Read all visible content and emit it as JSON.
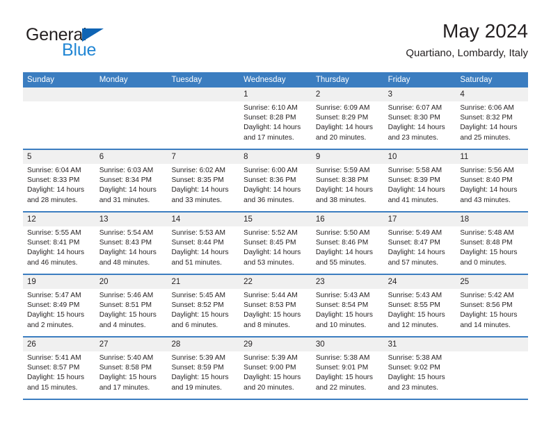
{
  "logo": {
    "text_top": "General",
    "text_bottom": "Blue",
    "triangle_icon": "triangle-icon",
    "color_dark": "#231f20",
    "color_blue": "#2186d4"
  },
  "header": {
    "title": "May 2024",
    "subtitle": "Quartiano, Lombardy, Italy"
  },
  "theme": {
    "header_blue": "#3b7dc0",
    "day_head_gray": "#f0f0f0",
    "text": "#231f20"
  },
  "weekdays": [
    "Sunday",
    "Monday",
    "Tuesday",
    "Wednesday",
    "Thursday",
    "Friday",
    "Saturday"
  ],
  "weeks": [
    [
      {
        "day": "",
        "lines": []
      },
      {
        "day": "",
        "lines": []
      },
      {
        "day": "",
        "lines": []
      },
      {
        "day": "1",
        "lines": [
          "Sunrise: 6:10 AM",
          "Sunset: 8:28 PM",
          "Daylight: 14 hours",
          "and 17 minutes."
        ]
      },
      {
        "day": "2",
        "lines": [
          "Sunrise: 6:09 AM",
          "Sunset: 8:29 PM",
          "Daylight: 14 hours",
          "and 20 minutes."
        ]
      },
      {
        "day": "3",
        "lines": [
          "Sunrise: 6:07 AM",
          "Sunset: 8:30 PM",
          "Daylight: 14 hours",
          "and 23 minutes."
        ]
      },
      {
        "day": "4",
        "lines": [
          "Sunrise: 6:06 AM",
          "Sunset: 8:32 PM",
          "Daylight: 14 hours",
          "and 25 minutes."
        ]
      }
    ],
    [
      {
        "day": "5",
        "lines": [
          "Sunrise: 6:04 AM",
          "Sunset: 8:33 PM",
          "Daylight: 14 hours",
          "and 28 minutes."
        ]
      },
      {
        "day": "6",
        "lines": [
          "Sunrise: 6:03 AM",
          "Sunset: 8:34 PM",
          "Daylight: 14 hours",
          "and 31 minutes."
        ]
      },
      {
        "day": "7",
        "lines": [
          "Sunrise: 6:02 AM",
          "Sunset: 8:35 PM",
          "Daylight: 14 hours",
          "and 33 minutes."
        ]
      },
      {
        "day": "8",
        "lines": [
          "Sunrise: 6:00 AM",
          "Sunset: 8:36 PM",
          "Daylight: 14 hours",
          "and 36 minutes."
        ]
      },
      {
        "day": "9",
        "lines": [
          "Sunrise: 5:59 AM",
          "Sunset: 8:38 PM",
          "Daylight: 14 hours",
          "and 38 minutes."
        ]
      },
      {
        "day": "10",
        "lines": [
          "Sunrise: 5:58 AM",
          "Sunset: 8:39 PM",
          "Daylight: 14 hours",
          "and 41 minutes."
        ]
      },
      {
        "day": "11",
        "lines": [
          "Sunrise: 5:56 AM",
          "Sunset: 8:40 PM",
          "Daylight: 14 hours",
          "and 43 minutes."
        ]
      }
    ],
    [
      {
        "day": "12",
        "lines": [
          "Sunrise: 5:55 AM",
          "Sunset: 8:41 PM",
          "Daylight: 14 hours",
          "and 46 minutes."
        ]
      },
      {
        "day": "13",
        "lines": [
          "Sunrise: 5:54 AM",
          "Sunset: 8:43 PM",
          "Daylight: 14 hours",
          "and 48 minutes."
        ]
      },
      {
        "day": "14",
        "lines": [
          "Sunrise: 5:53 AM",
          "Sunset: 8:44 PM",
          "Daylight: 14 hours",
          "and 51 minutes."
        ]
      },
      {
        "day": "15",
        "lines": [
          "Sunrise: 5:52 AM",
          "Sunset: 8:45 PM",
          "Daylight: 14 hours",
          "and 53 minutes."
        ]
      },
      {
        "day": "16",
        "lines": [
          "Sunrise: 5:50 AM",
          "Sunset: 8:46 PM",
          "Daylight: 14 hours",
          "and 55 minutes."
        ]
      },
      {
        "day": "17",
        "lines": [
          "Sunrise: 5:49 AM",
          "Sunset: 8:47 PM",
          "Daylight: 14 hours",
          "and 57 minutes."
        ]
      },
      {
        "day": "18",
        "lines": [
          "Sunrise: 5:48 AM",
          "Sunset: 8:48 PM",
          "Daylight: 15 hours",
          "and 0 minutes."
        ]
      }
    ],
    [
      {
        "day": "19",
        "lines": [
          "Sunrise: 5:47 AM",
          "Sunset: 8:49 PM",
          "Daylight: 15 hours",
          "and 2 minutes."
        ]
      },
      {
        "day": "20",
        "lines": [
          "Sunrise: 5:46 AM",
          "Sunset: 8:51 PM",
          "Daylight: 15 hours",
          "and 4 minutes."
        ]
      },
      {
        "day": "21",
        "lines": [
          "Sunrise: 5:45 AM",
          "Sunset: 8:52 PM",
          "Daylight: 15 hours",
          "and 6 minutes."
        ]
      },
      {
        "day": "22",
        "lines": [
          "Sunrise: 5:44 AM",
          "Sunset: 8:53 PM",
          "Daylight: 15 hours",
          "and 8 minutes."
        ]
      },
      {
        "day": "23",
        "lines": [
          "Sunrise: 5:43 AM",
          "Sunset: 8:54 PM",
          "Daylight: 15 hours",
          "and 10 minutes."
        ]
      },
      {
        "day": "24",
        "lines": [
          "Sunrise: 5:43 AM",
          "Sunset: 8:55 PM",
          "Daylight: 15 hours",
          "and 12 minutes."
        ]
      },
      {
        "day": "25",
        "lines": [
          "Sunrise: 5:42 AM",
          "Sunset: 8:56 PM",
          "Daylight: 15 hours",
          "and 14 minutes."
        ]
      }
    ],
    [
      {
        "day": "26",
        "lines": [
          "Sunrise: 5:41 AM",
          "Sunset: 8:57 PM",
          "Daylight: 15 hours",
          "and 15 minutes."
        ]
      },
      {
        "day": "27",
        "lines": [
          "Sunrise: 5:40 AM",
          "Sunset: 8:58 PM",
          "Daylight: 15 hours",
          "and 17 minutes."
        ]
      },
      {
        "day": "28",
        "lines": [
          "Sunrise: 5:39 AM",
          "Sunset: 8:59 PM",
          "Daylight: 15 hours",
          "and 19 minutes."
        ]
      },
      {
        "day": "29",
        "lines": [
          "Sunrise: 5:39 AM",
          "Sunset: 9:00 PM",
          "Daylight: 15 hours",
          "and 20 minutes."
        ]
      },
      {
        "day": "30",
        "lines": [
          "Sunrise: 5:38 AM",
          "Sunset: 9:01 PM",
          "Daylight: 15 hours",
          "and 22 minutes."
        ]
      },
      {
        "day": "31",
        "lines": [
          "Sunrise: 5:38 AM",
          "Sunset: 9:02 PM",
          "Daylight: 15 hours",
          "and 23 minutes."
        ]
      },
      {
        "day": "",
        "lines": []
      }
    ]
  ]
}
